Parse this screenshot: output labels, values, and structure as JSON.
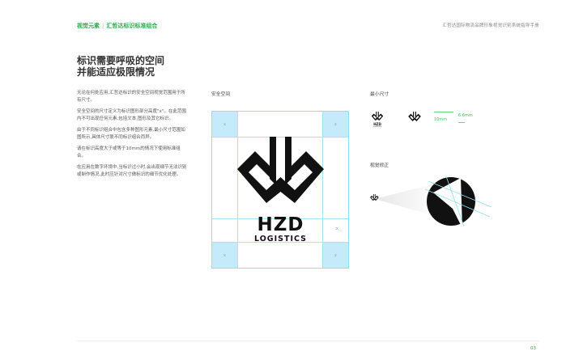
{
  "header": {
    "section": "视觉元素",
    "separator": "|",
    "subsection": "汇哲达标识标准组合",
    "manual_title": "汇哲达国际物流品牌形象视觉识别系统指导手册"
  },
  "title": {
    "line1": "标识需要呼吸的空间",
    "line2": "并能适应极限情况"
  },
  "paragraphs": [
    "无论在何处应用,汇哲达标识的安全空间视觉范围用于所有尺寸。",
    "安全空间的尺寸定义为标识图形部分高度\"x\"。在此范围内不可出现任何元素,包括文本,图形及其它标识。",
    "由于不同标识组合中包含多种图形元素,最小尺寸范围如图所示,具体尺寸联不同标识组合而异。",
    "请在标识高度大于或等于10mm的情况下使用标准组合。",
    "在应用在数字环境中,当标识过小时,会出现细节无法识别或制作情况,此时应针对尺寸做标识的细节优化处理。"
  ],
  "safe_space": {
    "label": "安全空间",
    "marker": "x",
    "logo_name": "HZD",
    "logo_tagline": "LOGISTICS"
  },
  "min_size": {
    "label": "最小尺寸",
    "size_a": "10mm",
    "size_b": "6.6mm",
    "mini_name": "HZD",
    "mini_tagline": "LOGISTICS"
  },
  "visual_correction": {
    "label": "视觉修正"
  },
  "colors": {
    "accent": "#2fa84a",
    "safe_zone": "#c5eafa",
    "guide_line": "#8fe0f0",
    "logo": "#111111"
  },
  "footer": {
    "page_number": "03"
  }
}
